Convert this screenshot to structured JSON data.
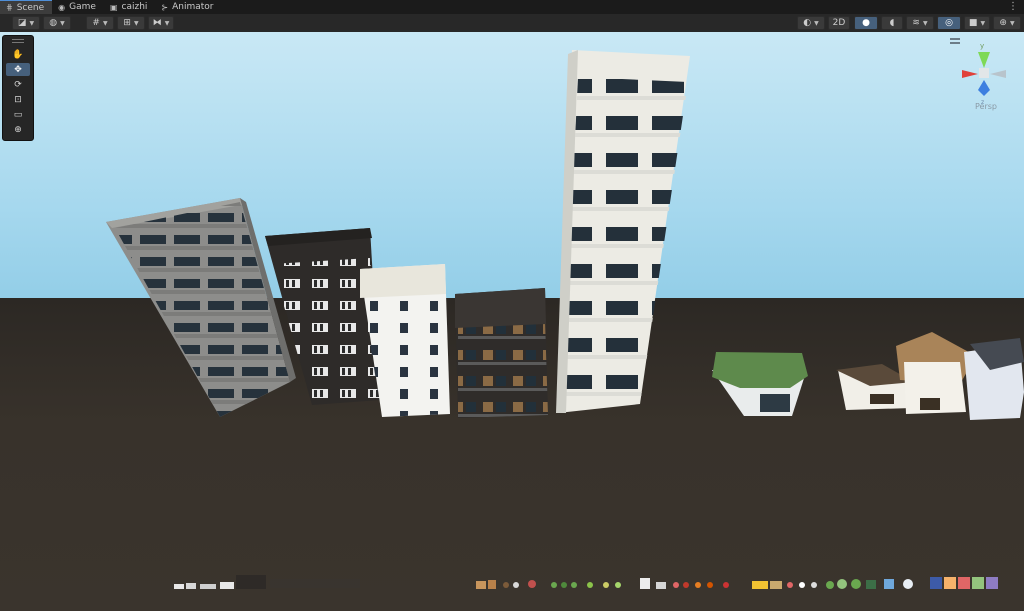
{
  "tabs": [
    {
      "label": "Scene",
      "icon": "grid-icon",
      "active": true
    },
    {
      "label": "Game",
      "icon": "gamepad-icon",
      "active": false
    },
    {
      "label": "caizhi",
      "icon": "package-icon",
      "active": false
    },
    {
      "label": "Animator",
      "icon": "animator-icon",
      "active": false
    }
  ],
  "toolbar": {
    "twod_label": "2D"
  },
  "tools": [
    {
      "name": "hand-tool",
      "glyph": "✋"
    },
    {
      "name": "move-tool",
      "glyph": "✥"
    },
    {
      "name": "rotate-tool",
      "glyph": "⟳"
    },
    {
      "name": "scale-tool",
      "glyph": "⊡"
    },
    {
      "name": "rect-tool",
      "glyph": "▭"
    },
    {
      "name": "transform-tool",
      "glyph": "⊕"
    }
  ],
  "gizmo": {
    "projection_label": "Persp",
    "y_label": "y",
    "z_label": "z"
  },
  "colors": {
    "accent": "#46607c",
    "gizmo_x": "#e0413a",
    "gizmo_y": "#7ed957",
    "gizmo_z": "#3d7fe0"
  }
}
